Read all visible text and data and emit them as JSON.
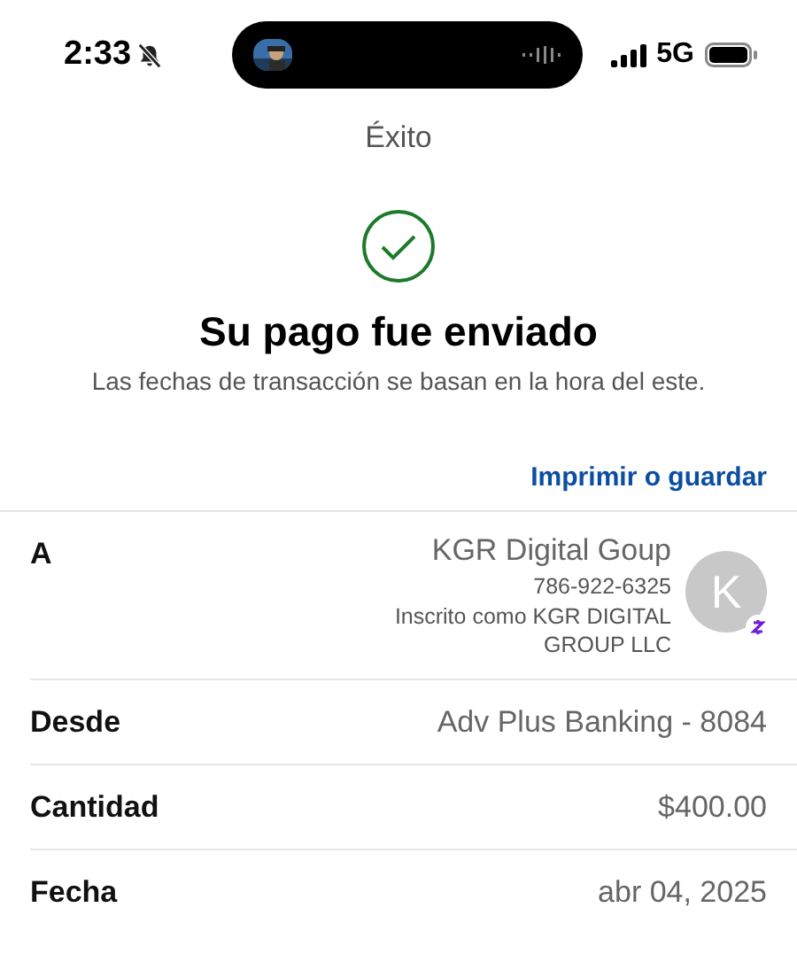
{
  "status_bar": {
    "time": "2:33",
    "network": "5G"
  },
  "header": {
    "title": "Éxito"
  },
  "confirmation": {
    "heading": "Su pago fue enviado",
    "note": "Las fechas de transacción se basan en la hora del este."
  },
  "print_link": "Imprimir o guardar",
  "details": [
    {
      "kind": "recipient",
      "label": "A",
      "name": "KGR Digital Goup",
      "phone": "786-922-6325",
      "enrolled": "Inscrito como KGR DIGITAL GROUP LLC",
      "avatar": "K"
    },
    {
      "kind": "simple",
      "label": "Desde",
      "value": "Adv Plus Banking - 8084"
    },
    {
      "kind": "simple",
      "label": "Cantidad",
      "value": "$400.00"
    },
    {
      "kind": "simple",
      "label": "Fecha",
      "value": "abr 04, 2025"
    }
  ]
}
